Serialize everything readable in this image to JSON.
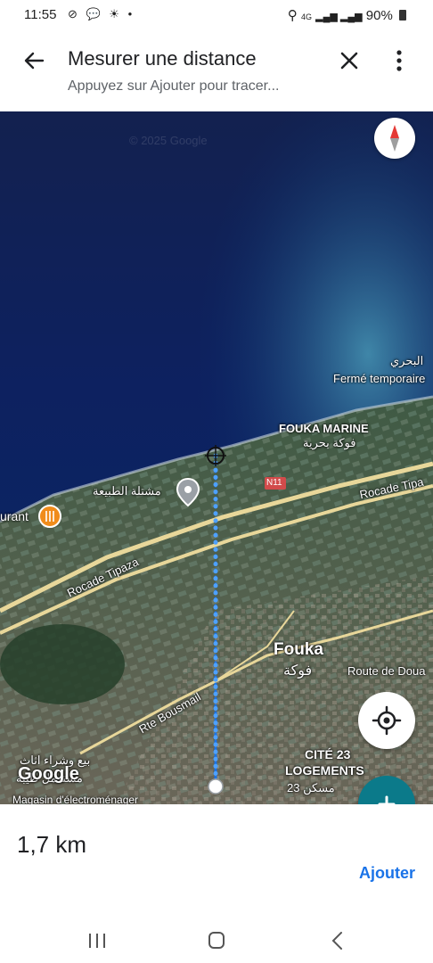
{
  "status": {
    "time": "11:55",
    "icons_left": [
      "notification-muted-icon",
      "chat-icon",
      "brightness-icon",
      "dot-icon"
    ],
    "network": "4G",
    "battery": "90%"
  },
  "header": {
    "title": "Mesurer une distance",
    "subtitle": "Appuyez sur Ajouter pour tracer..."
  },
  "map": {
    "labels": {
      "bahri": "البحري",
      "closed": "Fermé temporaire",
      "fouka_marine": "FOUKA MARINE",
      "fouka_marine_ar": "فوكة بحرية",
      "mashtala": "مشتلة الطبيعة",
      "n11": "N11",
      "rocade_right": "Rocade Tipa",
      "rocade_left": "Rocade Tipaza",
      "restaurant": "urant",
      "fouka": "Fouka",
      "fouka_ar": "فوكة",
      "route_douaouda": "Route de Doua",
      "rte_bousmail": "Rte Bousmail",
      "cite1": "CITÉ 23",
      "cite2": "LOGEMENTS",
      "cite_ar": "23 مسكن",
      "shop_ar": "بيع وشراء اثاث",
      "shop_ar2": "مستعمل طيبة",
      "shop": "Magasin d'électroménager",
      "watermark": "© 2025 Google",
      "google": "Google"
    },
    "accent": "#1a73e8"
  },
  "bottom": {
    "distance": "1,7 km",
    "add_label": "Ajouter"
  }
}
